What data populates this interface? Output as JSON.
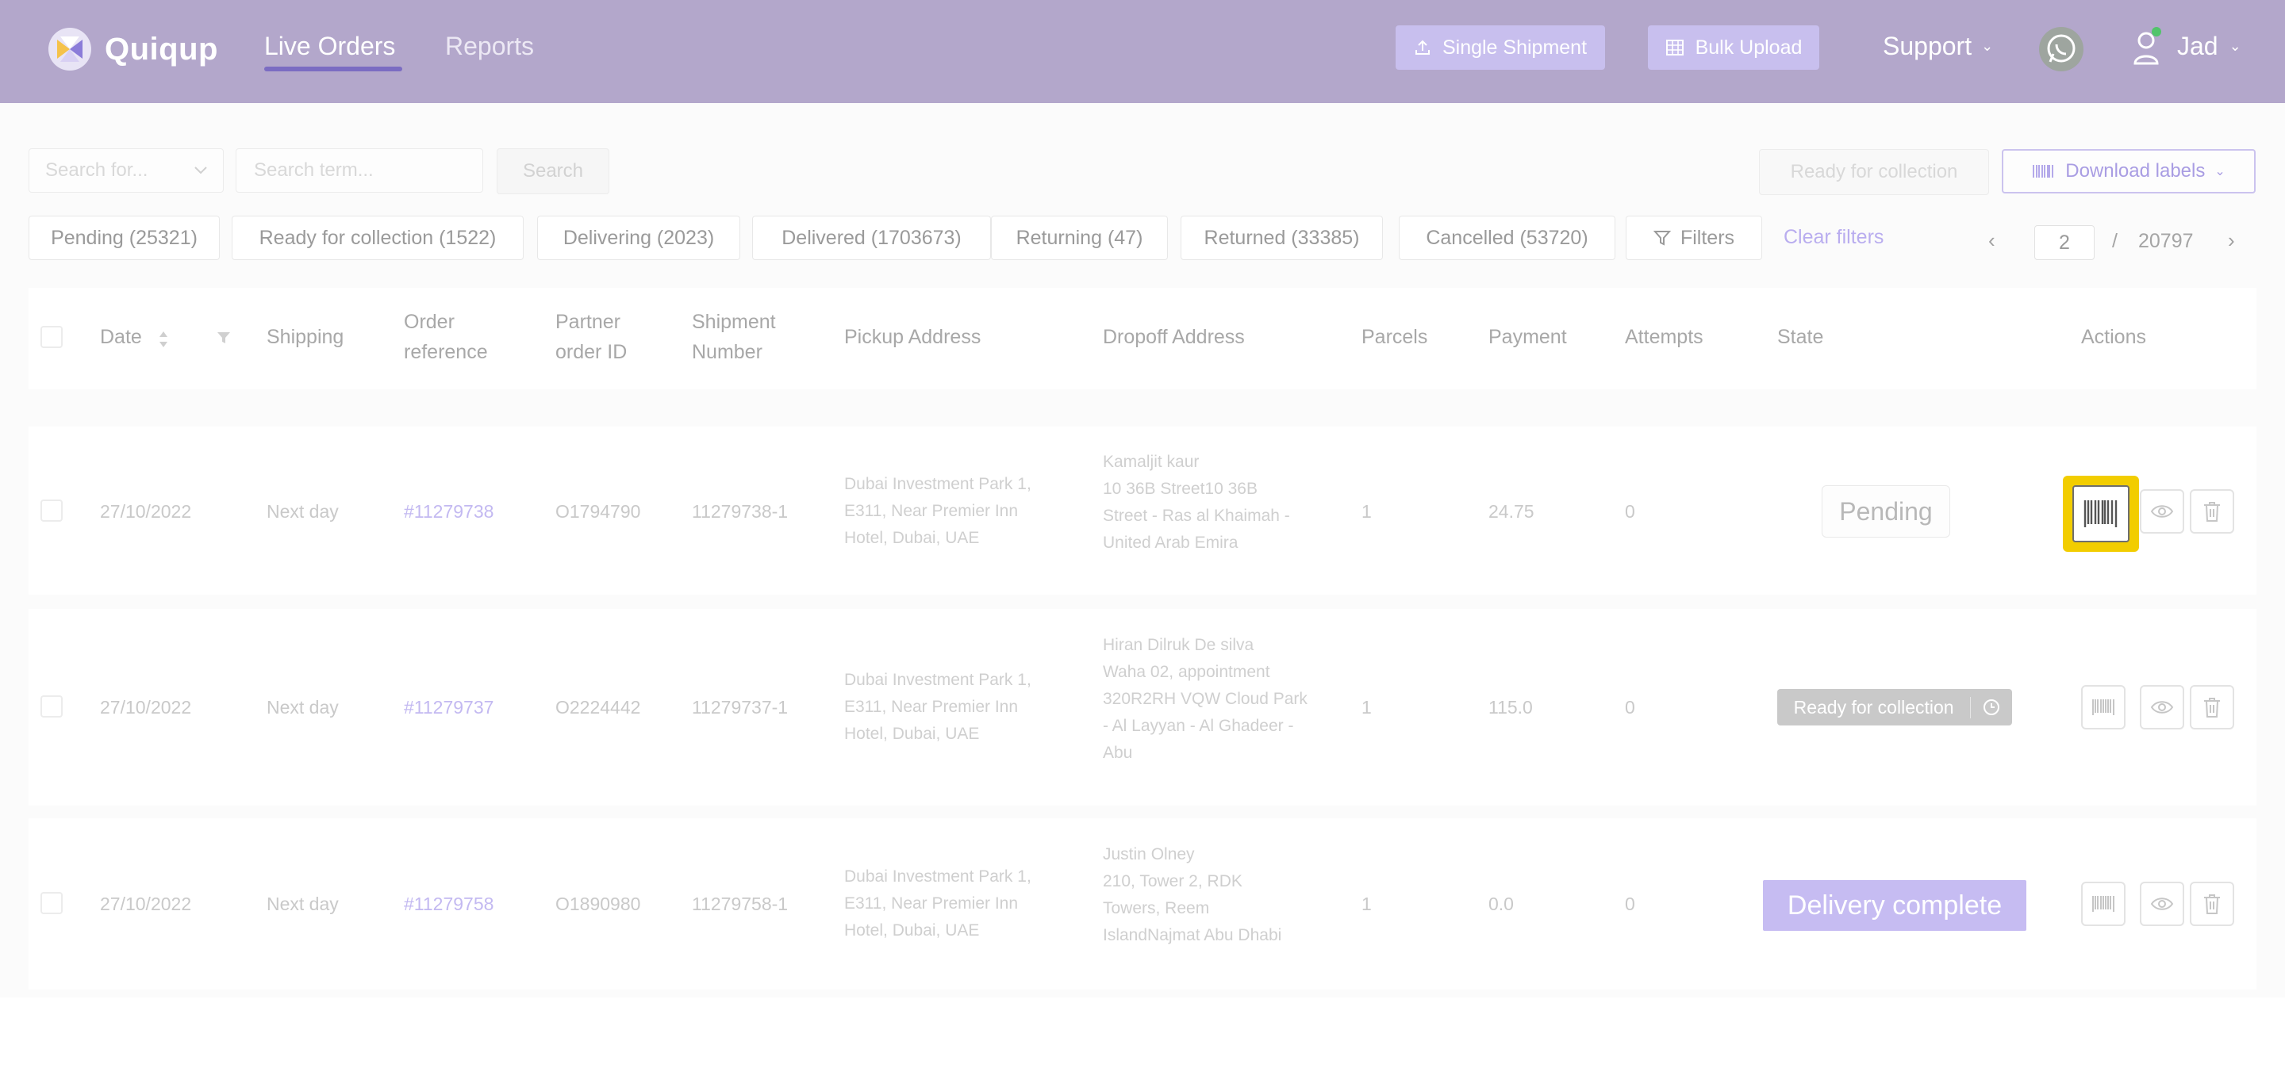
{
  "header": {
    "logo_text": "Quiqup",
    "nav": [
      {
        "label": "Live Orders",
        "active": true
      },
      {
        "label": "Reports",
        "active": false
      }
    ],
    "single_shipment": "Single Shipment",
    "bulk_upload": "Bulk Upload",
    "support": "Support",
    "user": "Jad",
    "icons": [
      "upload-icon",
      "table-icon",
      "whatsapp-icon",
      "user-icon",
      "chevron-down-icon"
    ]
  },
  "toolbar": {
    "search_for_placeholder": "Search for...",
    "search_term_placeholder": "Search term...",
    "search_button": "Search",
    "ready_for_collection": "Ready for collection",
    "download_labels": "Download labels"
  },
  "filters": {
    "chips": [
      "Pending (25321)",
      "Ready for collection (1522)",
      "Delivering (2023)",
      "Delivered (1703673)",
      "Returning (47)",
      "Returned (33385)",
      "Cancelled (53720)",
      "Filters"
    ],
    "clear": "Clear filters"
  },
  "pager": {
    "current": "2",
    "separator": "/",
    "total": "20797"
  },
  "table": {
    "headers": {
      "date": "Date",
      "shipping": "Shipping",
      "order_ref_1": "Order",
      "order_ref_2": "reference",
      "partner_1": "Partner",
      "partner_2": "order ID",
      "shipment_1": "Shipment",
      "shipment_2": "Number",
      "pickup": "Pickup Address",
      "dropoff": "Dropoff Address",
      "parcels": "Parcels",
      "payment": "Payment",
      "attempts": "Attempts",
      "state": "State",
      "actions": "Actions"
    },
    "rows": [
      {
        "date": "27/10/2022",
        "shipping": "Next day",
        "order_ref": "#11279738",
        "partner_id": "O1794790",
        "shipment": "11279738-1",
        "pickup": [
          "Dubai Investment Park 1,",
          "E311, Near Premier Inn",
          "Hotel, Dubai, UAE"
        ],
        "dropoff": [
          "Kamaljit kaur",
          "10 36B Street10 36B",
          "Street - Ras al Khaimah -",
          "United Arab Emira"
        ],
        "parcels": "1",
        "payment": "24.75",
        "attempts": "0",
        "state": "Pending"
      },
      {
        "date": "27/10/2022",
        "shipping": "Next day",
        "order_ref": "#11279737",
        "partner_id": "O2224442",
        "shipment": "11279737-1",
        "pickup": [
          "Dubai Investment Park 1,",
          "E311, Near Premier Inn",
          "Hotel, Dubai, UAE"
        ],
        "dropoff": [
          "Hiran Dilruk De silva",
          "Waha 02, appointment",
          "320R2RH VQW Cloud Park",
          "- Al Layyan - Al Ghadeer -",
          "Abu"
        ],
        "parcels": "1",
        "payment": "115.0",
        "attempts": "0",
        "state": "Ready for collection"
      },
      {
        "date": "27/10/2022",
        "shipping": "Next day",
        "order_ref": "#11279758",
        "partner_id": "O1890980",
        "shipment": "11279758-1",
        "pickup": [
          "Dubai Investment Park 1,",
          "E311, Near Premier Inn",
          "Hotel, Dubai, UAE"
        ],
        "dropoff": [
          "Justin Olney",
          "210, Tower 2, RDK",
          "Towers, Reem",
          "IslandNajmat Abu Dhabi"
        ],
        "parcels": "1",
        "payment": "0.0",
        "attempts": "0",
        "state": "Delivery complete"
      }
    ]
  },
  "colors": {
    "header_bg": "#b3a7cb",
    "accent": "#c6bcf2",
    "highlight": "#f2cd00",
    "ready_badge": "#c9c9c9"
  }
}
